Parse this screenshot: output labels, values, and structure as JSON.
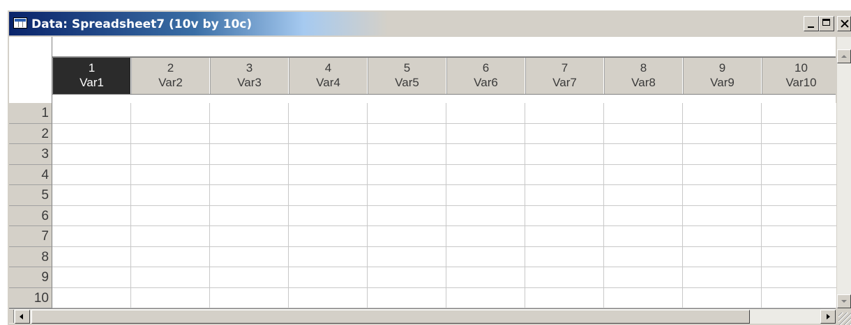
{
  "window": {
    "title": "Data: Spreadsheet7 (10v by 10c)"
  },
  "columns": [
    {
      "number": "1",
      "name": "Var1",
      "selected": true
    },
    {
      "number": "2",
      "name": "Var2"
    },
    {
      "number": "3",
      "name": "Var3"
    },
    {
      "number": "4",
      "name": "Var4"
    },
    {
      "number": "5",
      "name": "Var5"
    },
    {
      "number": "6",
      "name": "Var6"
    },
    {
      "number": "7",
      "name": "Var7"
    },
    {
      "number": "8",
      "name": "Var8"
    },
    {
      "number": "9",
      "name": "Var9"
    },
    {
      "number": "10",
      "name": "Var10"
    }
  ],
  "rows": [
    "1",
    "2",
    "3",
    "4",
    "5",
    "6",
    "7",
    "8",
    "9",
    "10"
  ],
  "icons": {
    "window": "spreadsheet-icon",
    "minimize": "minimize-icon",
    "maximize": "maximize-icon",
    "close": "close-icon",
    "scroll_up": "arrow-up-icon",
    "scroll_down": "arrow-down-icon",
    "scroll_left": "arrow-left-icon",
    "scroll_right": "arrow-right-icon"
  }
}
